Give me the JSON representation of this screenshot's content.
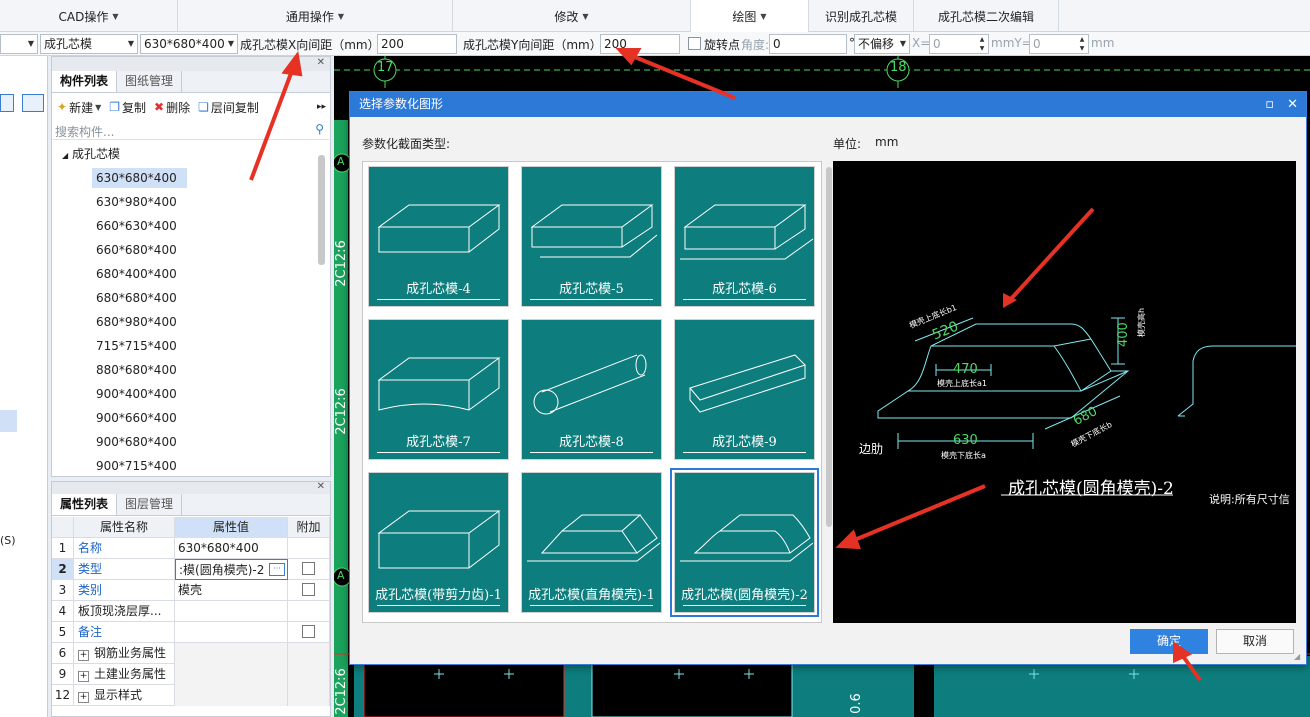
{
  "menubar": {
    "cad_ops": "CAD操作",
    "general_ops": "通用操作",
    "modify": "修改",
    "draw": "绘图",
    "identify": "识别成孔芯模",
    "secondary_edit": "成孔芯模二次编辑"
  },
  "toolbar": {
    "layer_select": "",
    "component_type": "成孔芯模",
    "component_size": "630*680*400",
    "x_spacing_label": "成孔芯模X向间距（mm）",
    "x_spacing_value": "200",
    "y_spacing_label": "成孔芯模Y向间距（mm）",
    "y_spacing_value": "200",
    "rotate_point_label": "旋转点",
    "angle_label": "角度:",
    "angle_value": "0",
    "degree_symbol": "°",
    "offset_mode": "不偏移",
    "x_label": "X=",
    "x_value": "0",
    "mm_y_label": "mmY=",
    "y_value": "0",
    "mm_label": "mm"
  },
  "component_panel": {
    "tab_list": "构件列表",
    "tab_drawings": "图纸管理",
    "new_label": "新建",
    "copy_label": "复制",
    "delete_label": "删除",
    "floor_copy_label": "层间复制",
    "search_placeholder": "搜索构件...",
    "root_label": "成孔芯模",
    "items": [
      "630*680*400",
      "630*980*400",
      "660*630*400",
      "660*680*400",
      "680*400*400",
      "680*680*400",
      "680*980*400",
      "715*715*400",
      "880*680*400",
      "900*400*400",
      "900*660*400",
      "900*680*400",
      "900*715*400"
    ]
  },
  "property_panel": {
    "tab_props": "属性列表",
    "tab_layers": "图层管理",
    "col_name": "属性名称",
    "col_value": "属性值",
    "col_extra": "附加",
    "rows": [
      {
        "num": "1",
        "name": "名称",
        "value": "630*680*400"
      },
      {
        "num": "2",
        "name": "类型",
        "value": ":模(圆角模壳)-2"
      },
      {
        "num": "3",
        "name": "类别",
        "value": "模壳"
      },
      {
        "num": "4",
        "name": "板顶现浇层厚...",
        "value": ""
      },
      {
        "num": "5",
        "name": "备注",
        "value": ""
      },
      {
        "num": "6",
        "name": "钢筋业务属性",
        "value": ""
      },
      {
        "num": "9",
        "name": "土建业务属性",
        "value": ""
      },
      {
        "num": "12",
        "name": "显示样式",
        "value": ""
      }
    ]
  },
  "left_panel": {
    "shortcut_label": "(S)"
  },
  "canvas": {
    "axis_17": "17",
    "axis_18": "18",
    "axis_a1": "A",
    "axis_a2": "A",
    "beam_labels": [
      "2C12:6",
      "2C12:6",
      "2C12:6"
    ],
    "bottom_label": "0.6"
  },
  "dialog": {
    "title": "选择参数化图形",
    "section_type_label": "参数化截面类型:",
    "unit_label": "单位:",
    "unit_value": "mm",
    "tiles": [
      "成孔芯模-4",
      "成孔芯模-5",
      "成孔芯模-6",
      "成孔芯模-7",
      "成孔芯模-8",
      "成孔芯模-9",
      "成孔芯模(带剪力齿)-1",
      "成孔芯模(直角模壳)-1",
      "成孔芯模(圆角模壳)-2"
    ],
    "selected_tile": "成孔芯模(圆角模壳)-2",
    "preview": {
      "dim_top_width": "520",
      "dim_top_length": "470",
      "dim_height": "400",
      "dim_bottom_length": "630",
      "dim_bottom_width": "680",
      "label_top_width": "模壳上底长b1",
      "label_top_length": "模壳上底长a1",
      "label_height": "模壳高h",
      "label_bottom_length": "模壳下底长a",
      "label_bottom_width": "模壳下底长b",
      "label_edge": "边肋",
      "title": "成孔芯模(圆角模壳)-2",
      "note": "说明:所有尺寸信"
    },
    "ok_label": "确定",
    "cancel_label": "取消"
  },
  "colors": {
    "accent": "#2d79d8",
    "tile_bg": "#0d7d7d",
    "annotation": "#e53224",
    "cad_cyan": "#7fe7ef",
    "cad_green": "#4cd964"
  }
}
